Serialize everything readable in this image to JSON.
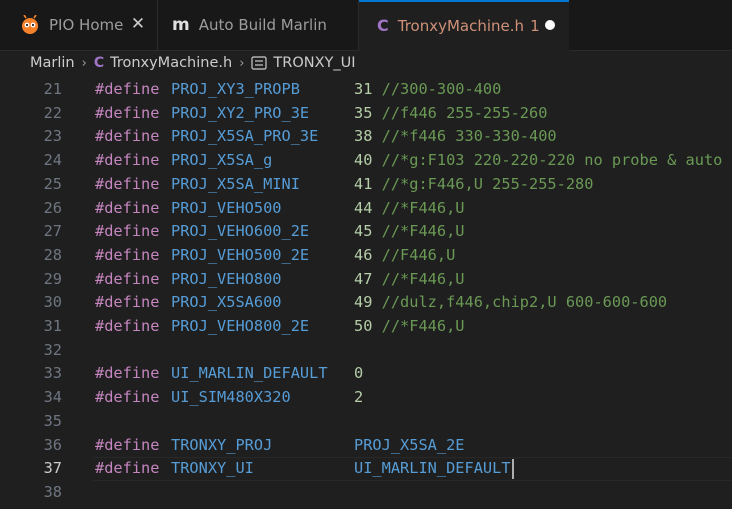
{
  "tabs": [
    {
      "label": "PIO Home",
      "icon": "platformio-ant-icon",
      "state": "closeable"
    },
    {
      "label": "Auto Build Marlin",
      "icon": "marlin-m-icon"
    },
    {
      "label": "TronxyMachine.h",
      "badge": "1",
      "icon": "c-language-icon",
      "state": "unsaved",
      "active": true
    }
  ],
  "breadcrumb": {
    "folder": "Marlin",
    "file": "TronxyMachine.h",
    "symbol": "TRONXY_UI"
  },
  "editor": {
    "lines": [
      {
        "n": "21",
        "kw": "#define",
        "name": "PROJ_XY3_PROPB",
        "value": "31",
        "comment": "//300-300-400"
      },
      {
        "n": "22",
        "kw": "#define",
        "name": "PROJ_XY2_PRO_3E",
        "value": "35",
        "comment": "//f446 255-255-260"
      },
      {
        "n": "23",
        "kw": "#define",
        "name": "PROJ_X5SA_PRO_3E",
        "value": "38",
        "comment": "//*f446 330-330-400"
      },
      {
        "n": "24",
        "kw": "#define",
        "name": "PROJ_X5SA_g",
        "value": "40",
        "comment": "//*g:F103 220-220-220 no probe & auto"
      },
      {
        "n": "25",
        "kw": "#define",
        "name": "PROJ_X5SA_MINI",
        "value": "41",
        "comment": "//*g:F446,U 255-255-280"
      },
      {
        "n": "26",
        "kw": "#define",
        "name": "PROJ_VEHO500",
        "value": "44",
        "comment": "//*F446,U"
      },
      {
        "n": "27",
        "kw": "#define",
        "name": "PROJ_VEHO600_2E",
        "value": "45",
        "comment": "//*F446,U"
      },
      {
        "n": "28",
        "kw": "#define",
        "name": "PROJ_VEHO500_2E",
        "value": "46",
        "comment": "//F446,U"
      },
      {
        "n": "29",
        "kw": "#define",
        "name": "PROJ_VEHO800",
        "value": "47",
        "comment": "//*F446,U"
      },
      {
        "n": "30",
        "kw": "#define",
        "name": "PROJ_X5SA600",
        "value": "49",
        "comment": "//dulz,f446,chip2,U 600-600-600"
      },
      {
        "n": "31",
        "kw": "#define",
        "name": "PROJ_VEHO800_2E",
        "value": "50",
        "comment": "//*F446,U"
      },
      {
        "n": "32",
        "kw": "",
        "name": "",
        "value": "",
        "comment": ""
      },
      {
        "n": "33",
        "kw": "#define",
        "name": "UI_MARLIN_DEFAULT",
        "value": "0",
        "comment": ""
      },
      {
        "n": "34",
        "kw": "#define",
        "name": "UI_SIM480X320",
        "value": "2",
        "comment": ""
      },
      {
        "n": "35",
        "kw": "",
        "name": "",
        "value": "",
        "comment": ""
      },
      {
        "n": "36",
        "kw": "#define",
        "name": "TRONXY_PROJ",
        "value": "PROJ_X5SA_2E",
        "comment": ""
      },
      {
        "n": "37",
        "kw": "#define",
        "name": "TRONXY_UI",
        "value": "UI_MARLIN_DEFAULT",
        "comment": ""
      },
      {
        "n": "38",
        "kw": "",
        "name": "",
        "value": "",
        "comment": ""
      }
    ],
    "current_line": "37"
  },
  "colors": {
    "keyword": "#c586c0",
    "macro": "#569cd6",
    "number": "#b5cea8",
    "comment": "#6a9955",
    "modified_tab": "#ce9178",
    "accent": "#0078d4"
  }
}
